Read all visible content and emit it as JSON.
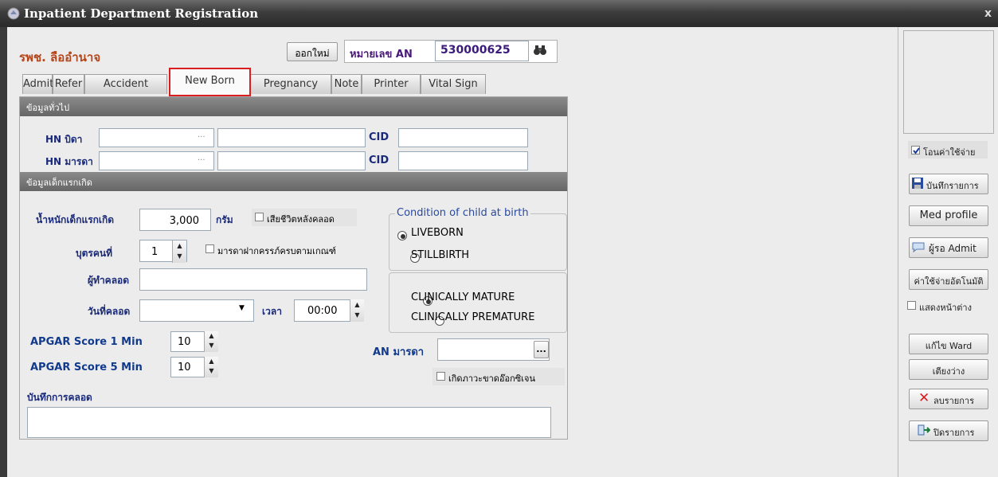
{
  "window": {
    "title": "Inpatient Department Registration",
    "close": "x"
  },
  "header": {
    "hospital": "รพช. ลืออำนาจ",
    "new_button": "ออกใหม่",
    "an_label": "หมายเลข AN",
    "an_value": "530000625"
  },
  "tabs": [
    "Admit",
    "Refer",
    "Accident",
    "New Born",
    "Pregnancy",
    "Note",
    "Printer",
    "Vital Sign"
  ],
  "general": {
    "title": "ข้อมูลทั่วไป",
    "hn_father": "HN บิดา",
    "hn_mother": "HN มารดา",
    "cid": "CID",
    "ellipsis": "..."
  },
  "newborn": {
    "title": "ข้อมูลเด็กแรกเกิด",
    "weight_label": "น้ำหนักเด็กแรกเกิด",
    "weight_value": "3,000",
    "weight_unit": "กรัม",
    "died_after_birth": "เสียชีวิตหลังคลอด",
    "child_no_label": "บุตรคนที่",
    "child_no_value": "1",
    "antenatal_check": "มารดาฝากครรภ์ครบตามเกณฑ์",
    "deliverer_label": "ผู้ทำคลอด",
    "date_label": "วันที่คลอด",
    "time_label": "เวลา",
    "time_value": "00:00",
    "apgar1_label": "APGAR Score 1 Min",
    "apgar1_value": "10",
    "apgar5_label": "APGAR Score 5 Min",
    "apgar5_value": "10",
    "condition_title": "Condition of child at birth",
    "liveborn": "LIVEBORN",
    "stillbirth": "STILLBIRTH",
    "mature": "CLINICALLY MATURE",
    "premature": "CLINICALLY PREMATURE",
    "an_mother_label": "AN มารดา",
    "an_mother_btn": "...",
    "oxygen_check": "เกิดภาวะขาดอ๊อกซิเจน",
    "note_label": "บันทึกการคลอด"
  },
  "sidebar": {
    "transfer_expense": "โอนค่าใช้จ่าย",
    "save": "บันทึกรายการ",
    "med_profile": "Med profile",
    "wait_admit": "ผู้รอ Admit",
    "auto_expense": "ค่าใช้จ่ายอัตโนมัติ",
    "show_window": "แสดงหน้าต่าง",
    "edit_ward": "แก้ไข Ward",
    "empty_bed": "เตียงว่าง",
    "delete": "ลบรายการ",
    "close": "ปิดรายการ"
  }
}
